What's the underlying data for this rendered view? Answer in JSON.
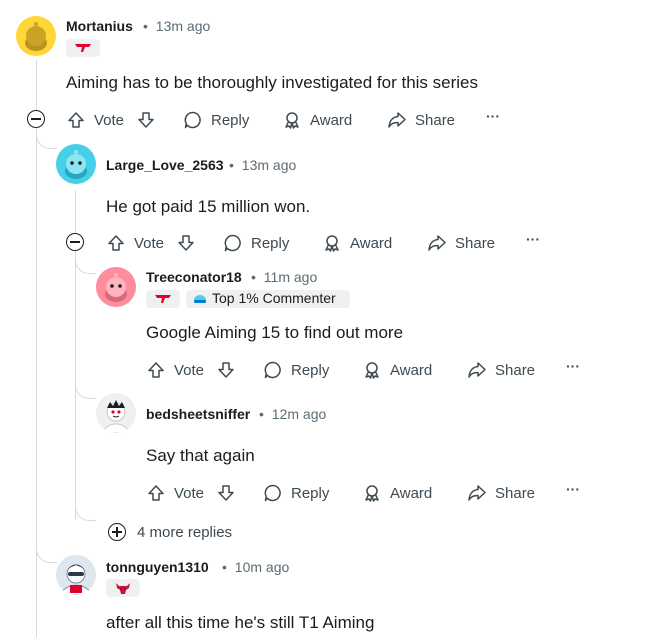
{
  "actions": {
    "vote": "Vote",
    "reply": "Reply",
    "award": "Award",
    "share": "Share",
    "more": "···"
  },
  "comments": [
    {
      "username": "Mortanius",
      "time": "13m ago",
      "text": "Aiming has to be thoroughly investigated for this series",
      "flair": "T1"
    },
    {
      "username": "Large_Love_2563",
      "time": "13m ago",
      "text": "He got paid 15 million won."
    },
    {
      "username": "Treeconator18",
      "time": "11m ago",
      "text": "Google Aiming 15 to find out more",
      "flair": "T1",
      "badge": "Top 1% Commenter"
    },
    {
      "username": "bedsheetsniffer",
      "time": "12m ago",
      "text": "Say that again"
    },
    {
      "username": "tonnguyen1310",
      "time": "10m ago",
      "text": "after all this time he's still T1 Aiming",
      "flair": "Bulls"
    }
  ],
  "more_replies": "4 more replies",
  "separator": "•",
  "colors": {
    "t1_red": "#e2012d",
    "avatar_yellow": "#ffd635",
    "avatar_teal": "#46d0e8",
    "avatar_pink": "#ff8c9c",
    "thread_line": "#d7dadc"
  }
}
